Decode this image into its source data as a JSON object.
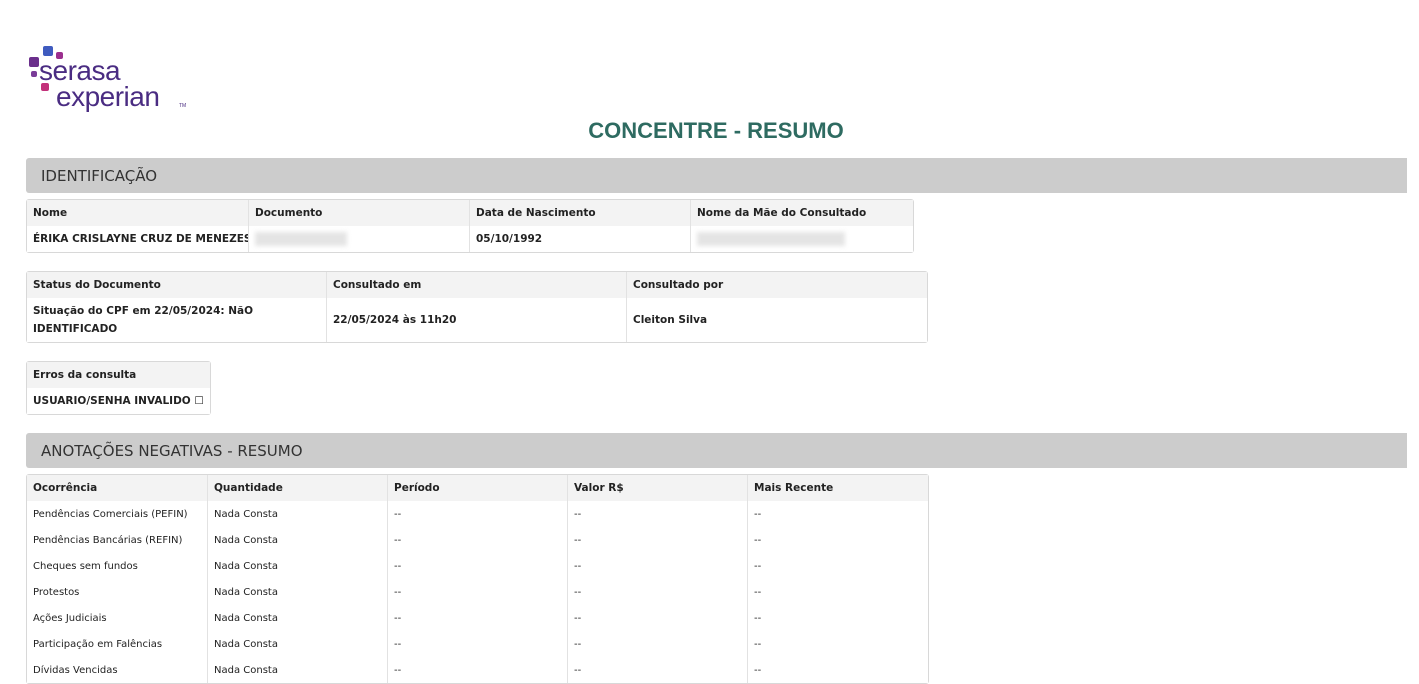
{
  "logo": {
    "line1": "serasa",
    "line2": "experian",
    "tm": "TM"
  },
  "page_title": "CONCENTRE - RESUMO",
  "identificacao": {
    "section_title": "IDENTIFICAÇÃO",
    "headers": [
      "Nome",
      "Documento",
      "Data de Nascimento",
      "Nome da Mãe do Consultado"
    ],
    "values": {
      "nome": "ÉRIKA CRISLAYNE CRUZ DE MENEZES",
      "data_nascimento": "05/10/1992"
    }
  },
  "status": {
    "headers": [
      "Status do Documento",
      "Consultado em",
      "Consultado por"
    ],
    "values": [
      "Situação do CPF em 22/05/2024: NãO IDENTIFICADO",
      "22/05/2024 às 11h20",
      "Cleiton Silva"
    ]
  },
  "erros": {
    "header": "Erros da consulta",
    "value": "USUARIO/SENHA INVALIDO ☐"
  },
  "anotacoes": {
    "section_title": "ANOTAÇÕES NEGATIVAS - RESUMO",
    "headers": [
      "Ocorrência",
      "Quantidade",
      "Período",
      "Valor R$",
      "Mais Recente"
    ],
    "rows": [
      [
        "Pendências Comerciais (PEFIN)",
        "Nada Consta",
        "--",
        "--",
        "--"
      ],
      [
        "Pendências Bancárias (REFIN)",
        "Nada Consta",
        "--",
        "--",
        "--"
      ],
      [
        "Cheques sem fundos",
        "Nada Consta",
        "--",
        "--",
        "--"
      ],
      [
        "Protestos",
        "Nada Consta",
        "--",
        "--",
        "--"
      ],
      [
        "Ações Judiciais",
        "Nada Consta",
        "--",
        "--",
        "--"
      ],
      [
        "Participação em Falências",
        "Nada Consta",
        "--",
        "--",
        "--"
      ],
      [
        "Dívidas Vencidas",
        "Nada Consta",
        "--",
        "--",
        "--"
      ]
    ]
  },
  "colors": {
    "title": "#2e6b61",
    "section_bar": "#cccccc",
    "logo_text": "#4a2c82"
  }
}
